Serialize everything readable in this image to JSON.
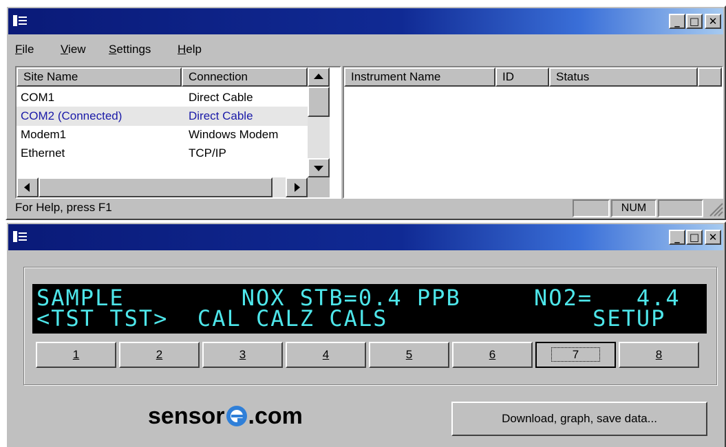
{
  "window1": {
    "menu": [
      "File",
      "View",
      "Settings",
      "Help"
    ],
    "sites_table": {
      "columns": [
        "Site Name",
        "Connection"
      ],
      "rows": [
        {
          "site": "COM1",
          "connection": "Direct Cable"
        },
        {
          "site": "COM2 (Connected)",
          "connection": "Direct Cable"
        },
        {
          "site": "Modem1",
          "connection": "Windows Modem"
        },
        {
          "site": "Ethernet",
          "connection": "TCP/IP"
        }
      ]
    },
    "instruments_table": {
      "columns": [
        "Instrument Name",
        "ID",
        "Status"
      ]
    },
    "status": {
      "help": "For Help, press F1",
      "num": "NUM"
    }
  },
  "window2": {
    "display": {
      "line1": "SAMPLE        NOX STB=0.4 PPB     NO2=   4.4",
      "line2": "<TST TST>  CAL CALZ CALS              SETUP"
    },
    "keys": [
      "1",
      "2",
      "3",
      "4",
      "5",
      "6",
      "7",
      "8"
    ],
    "logo_left": "sensor",
    "logo_right": ".com",
    "download_label": "Download, graph, save data..."
  },
  "colors": {
    "lcd_text": "#4ee6ea",
    "lcd_bg": "#000000",
    "selected_row_text": "#1a1aa8",
    "logo_accent": "#2f7fd8"
  },
  "icons": [
    "system-menu-icon",
    "minimize-icon",
    "maximize-icon",
    "close-icon",
    "scroll-up-arrow-icon",
    "scroll-down-arrow-icon",
    "scroll-left-arrow-icon",
    "scroll-right-arrow-icon",
    "size-grip-icon",
    "sensor-e-logo-icon"
  ]
}
